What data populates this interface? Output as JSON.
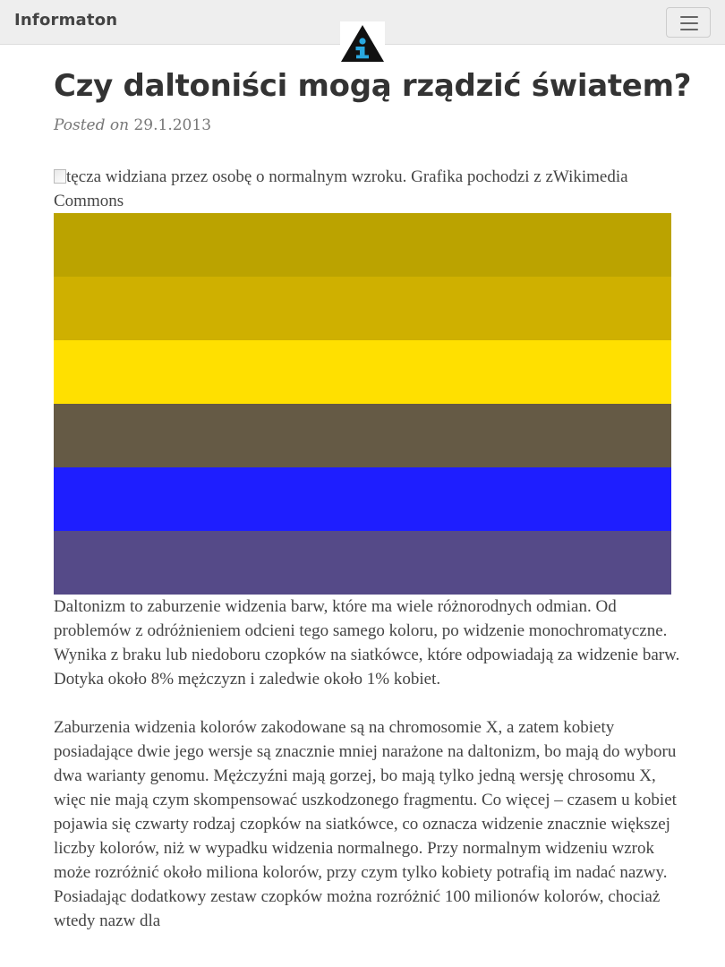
{
  "navbar": {
    "brand": "Informaton",
    "logo_icon": "info-triangle-logo",
    "toggle_icon": "hamburger-menu-icon"
  },
  "post": {
    "title": "Czy daltoniści mogą rządzić światem?",
    "posted_label": "Posted on",
    "date": "29.1.2013",
    "image_alt": "tęcza widziana przez osobę o normalnym wzroku. Grafika pochodzi z zWikimedia Commons",
    "stripe_colors": [
      "#bba300",
      "#cfb000",
      "#ffe000",
      "#655a45",
      "#1e1eff",
      "#554a88"
    ],
    "paragraphs": [
      "Daltonizm to zaburzenie widzenia barw, które ma wiele różnorodnych odmian. Od problemów z odróżnieniem odcieni tego samego koloru, po widzenie monochromatyczne. Wynika z braku lub niedoboru czopków na siatkówce, które odpowiadają za widzenie barw. Dotyka około 8% mężczyzn i zaledwie około 1% kobiet.",
      "Zaburzenia widzenia kolorów zakodowane są na chromosomie X, a zatem kobiety posiadające dwie jego wersje są znacznie mniej narażone na daltonizm, bo mają do wyboru dwa warianty genomu. Mężczyźni mają gorzej, bo mają tylko jedną wersję chrosomu X, więc nie mają czym skompensować uszkodzonego fragmentu. Co więcej – czasem u kobiet pojawia się czwarty rodzaj czopków na siatkówce, co oznacza widzenie znacznie większej liczby kolorów, niż w wypadku widzenia normalnego. Przy normalnym widzeniu wzrok może rozróżnić około miliona kolorów, przy czym tylko kobiety potrafią im nadać nazwy. Posiadając dodatkowy zestaw czopków można rozróżnić 100 milionów kolorów, chociaż wtedy nazw dla"
    ]
  },
  "colors": {
    "navbar_bg": "#eeeeee",
    "title": "#333333",
    "body_text": "#444444",
    "meta_text": "#777777"
  }
}
